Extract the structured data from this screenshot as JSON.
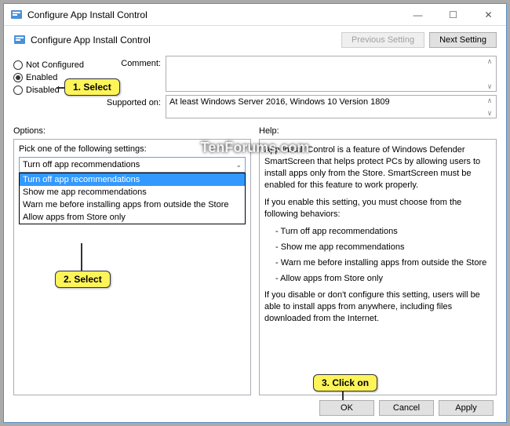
{
  "window": {
    "title": "Configure App Install Control"
  },
  "header": {
    "title": "Configure App Install Control",
    "prev": "Previous Setting",
    "next": "Next Setting"
  },
  "radios": {
    "not_configured": "Not Configured",
    "enabled": "Enabled",
    "disabled": "Disabled"
  },
  "fields": {
    "comment_label": "Comment:",
    "supported_label": "Supported on:",
    "supported_value": "At least Windows Server 2016, Windows 10 Version 1809"
  },
  "options": {
    "label": "Options:",
    "prompt": "Pick one of the following settings:",
    "selected": "Turn off app recommendations",
    "items": [
      "Turn off app recommendations",
      "Show me app recommendations",
      "Warn me before installing apps from outside the Store",
      "Allow apps from Store only"
    ]
  },
  "help": {
    "label": "Help:",
    "p1": "App Install Control is a feature of Windows Defender SmartScreen that helps protect PCs by allowing users to install apps only from the Store. SmartScreen must be enabled for this feature to work properly.",
    "p2": "If you enable this setting, you must choose from the following behaviors:",
    "b1": "Turn off app recommendations",
    "b2": "Show me app recommendations",
    "b3": "Warn me before installing apps from outside the Store",
    "b4": "Allow apps from Store only",
    "p3": "If you disable or don't configure this setting, users will be able to install apps from anywhere, including files downloaded from the Internet."
  },
  "footer": {
    "ok": "OK",
    "cancel": "Cancel",
    "apply": "Apply"
  },
  "callouts": {
    "c1": "1. Select",
    "c2": "2. Select",
    "c3": "3. Click on"
  },
  "watermark": "TenForums.com"
}
